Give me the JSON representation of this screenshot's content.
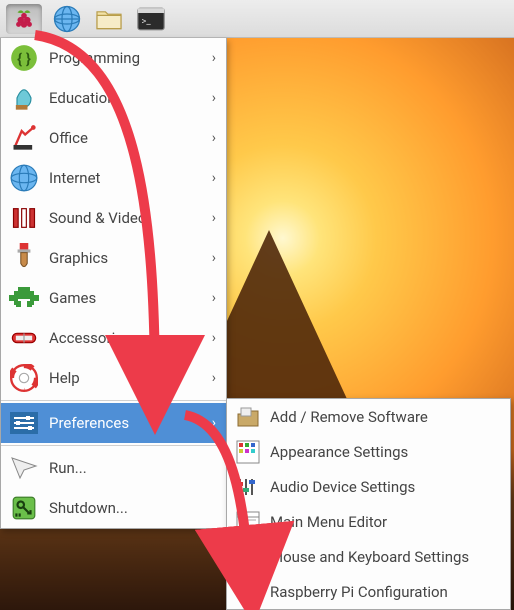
{
  "taskbar": {
    "buttons": [
      "raspberry-menu",
      "web-browser",
      "file-manager",
      "terminal"
    ]
  },
  "menu": {
    "items": [
      {
        "id": "programming",
        "label": "Programming",
        "submenu": true
      },
      {
        "id": "education",
        "label": "Education",
        "submenu": true
      },
      {
        "id": "office",
        "label": "Office",
        "submenu": true
      },
      {
        "id": "internet",
        "label": "Internet",
        "submenu": true
      },
      {
        "id": "sound-video",
        "label": "Sound & Video",
        "submenu": true
      },
      {
        "id": "graphics",
        "label": "Graphics",
        "submenu": true
      },
      {
        "id": "games",
        "label": "Games",
        "submenu": true
      },
      {
        "id": "accessories",
        "label": "Accessories",
        "submenu": true
      },
      {
        "id": "help",
        "label": "Help",
        "submenu": true
      },
      {
        "id": "preferences",
        "label": "Preferences",
        "submenu": true,
        "selected": true
      },
      {
        "id": "run",
        "label": "Run...",
        "submenu": false
      },
      {
        "id": "shutdown",
        "label": "Shutdown...",
        "submenu": false
      }
    ]
  },
  "submenu": {
    "items": [
      {
        "id": "add-remove",
        "label": "Add / Remove Software"
      },
      {
        "id": "appearance",
        "label": "Appearance Settings"
      },
      {
        "id": "audio",
        "label": "Audio Device Settings"
      },
      {
        "id": "main-menu-editor",
        "label": "Main Menu Editor"
      },
      {
        "id": "mouse-keyboard",
        "label": "Mouse and Keyboard Settings"
      },
      {
        "id": "rpi-config",
        "label": "Raspberry Pi Configuration"
      }
    ]
  },
  "colors": {
    "highlight": "#4f8fd6",
    "annotation": "#ed3b4a"
  }
}
